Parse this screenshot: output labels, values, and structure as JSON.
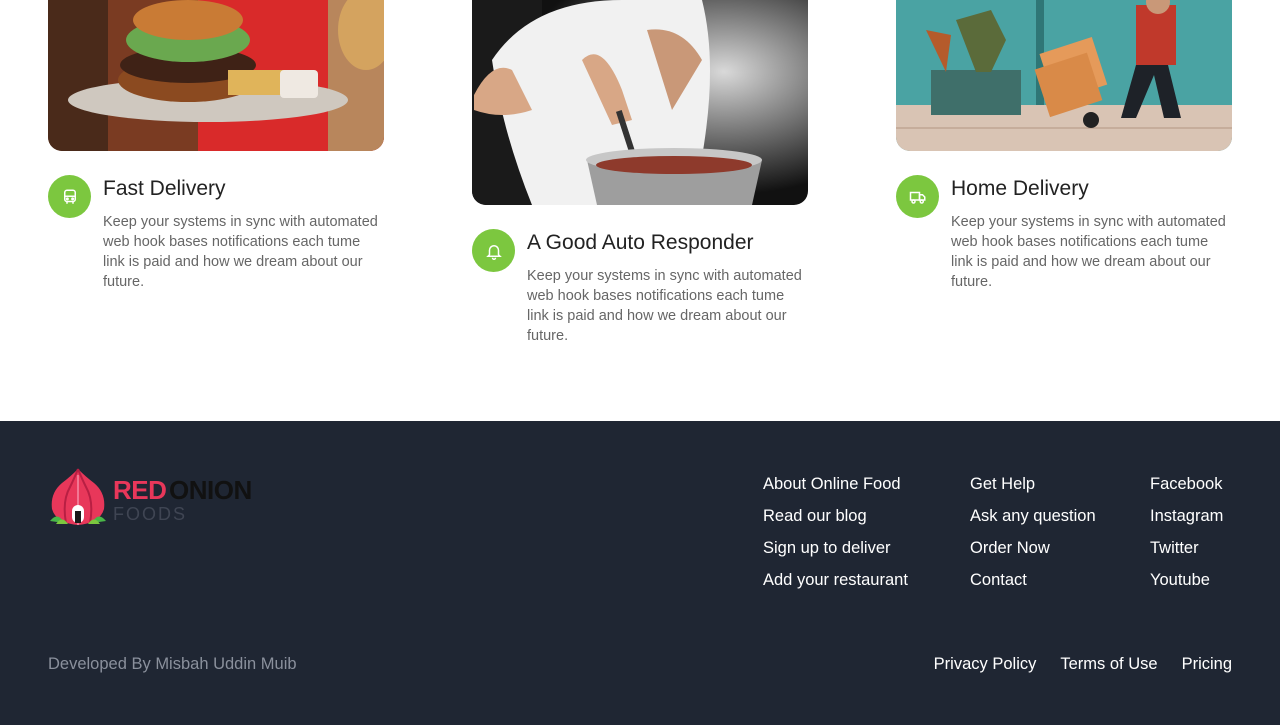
{
  "features": [
    {
      "title": "Fast Delivery",
      "text": "Keep your systems in sync with automated web hook bases notifications each tume link is paid and how we dream about our future.",
      "icon": "bus-icon",
      "image": "burger-plate-photo"
    },
    {
      "title": "A Good Auto Responder",
      "text": "Keep your systems in sync with automated web hook bases notifications each tume link is paid and how we dream about our future.",
      "icon": "bell-icon",
      "image": "chef-cooking-photo"
    },
    {
      "title": "Home Delivery",
      "text": "Keep your systems in sync with automated web hook bases notifications each tume link is paid and how we dream about our future.",
      "icon": "truck-icon",
      "image": "courier-delivery-photo"
    }
  ],
  "footer": {
    "logo": {
      "word1": "RED",
      "word2": "ONION",
      "word3": "FOODS"
    },
    "columns": [
      [
        "About Online Food",
        "Read our blog",
        "Sign up to deliver",
        "Add your restaurant"
      ],
      [
        "Get Help",
        "Ask any question",
        "Order Now",
        "Contact"
      ],
      [
        "Facebook",
        "Instagram",
        "Twitter",
        "Youtube"
      ]
    ],
    "credit": "Developed By Misbah Uddin Muib",
    "legal": [
      "Privacy Policy",
      "Terms of Use",
      "Pricing"
    ]
  },
  "colors": {
    "accent_green": "#7cc73f",
    "brand_red": "#e8375a",
    "footer_bg": "#1f2633"
  }
}
